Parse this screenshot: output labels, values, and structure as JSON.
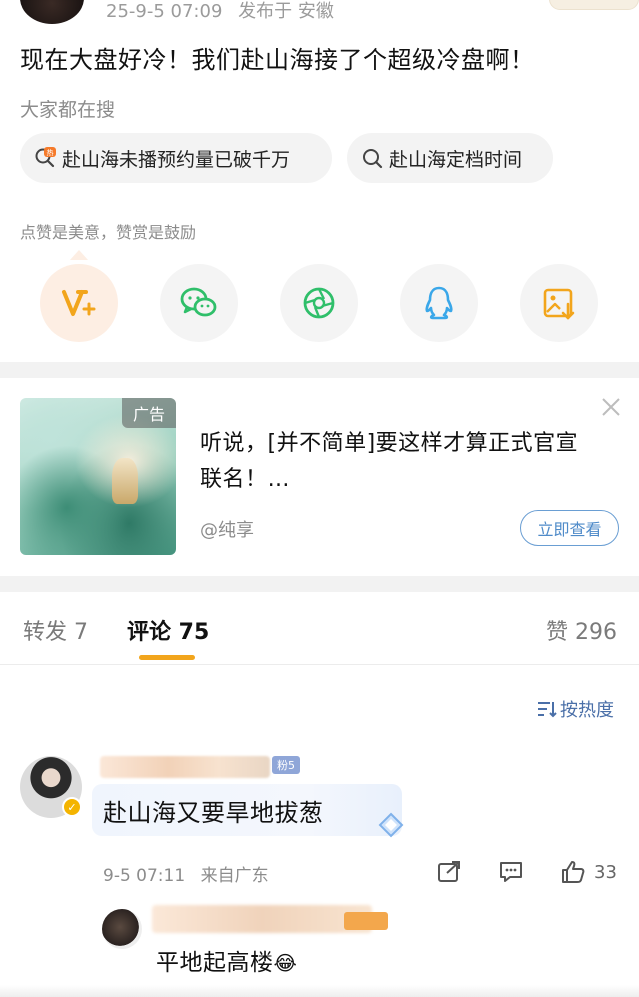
{
  "post": {
    "meta_time": "25-9-5 07:09",
    "meta_location": "发布于 安徽",
    "text": "现在大盘好冷！我们赴山海接了个超级冷盘啊！"
  },
  "search": {
    "label": "大家都在搜",
    "chips": [
      {
        "text": "赴山海未播预约量已破千万",
        "icon": "hot-search-icon"
      },
      {
        "text": "赴山海定档时间",
        "icon": "search-icon"
      }
    ]
  },
  "reward": {
    "tip": "点赞是美意，赞赏是鼓励",
    "buttons": [
      {
        "name": "reward-v-plus",
        "icon": "v-plus-icon",
        "color": "#f2a51c"
      },
      {
        "name": "wechat",
        "icon": "wechat-icon",
        "color": "#2fbf6a"
      },
      {
        "name": "moments",
        "icon": "moments-shutter-icon",
        "color": "#2fbf6a"
      },
      {
        "name": "qq",
        "icon": "qq-penguin-icon",
        "color": "#3aa7e9"
      },
      {
        "name": "save-image",
        "icon": "save-image-icon",
        "color": "#f2a51c"
      }
    ]
  },
  "ad": {
    "badge": "广告",
    "title": "听说，[并不简单]要这样才算正式官宣联名！…",
    "source": "@纯享",
    "cta": "立即查看"
  },
  "tabs": {
    "repost": "转发 7",
    "comment": "评论 75",
    "like": "赞 296"
  },
  "sort": {
    "label": "按热度"
  },
  "comment": {
    "fan_badge": "粉5",
    "text": "赴山海又要旱地拔葱",
    "time": "9-5 07:11",
    "location": "来自广东",
    "like_count": "33"
  },
  "reply": {
    "text": "平地起高楼",
    "emoji": "😂"
  },
  "colors": {
    "accent": "#f2a51c",
    "link_blue": "#4a6fa8",
    "muted": "#8c8c8c"
  }
}
